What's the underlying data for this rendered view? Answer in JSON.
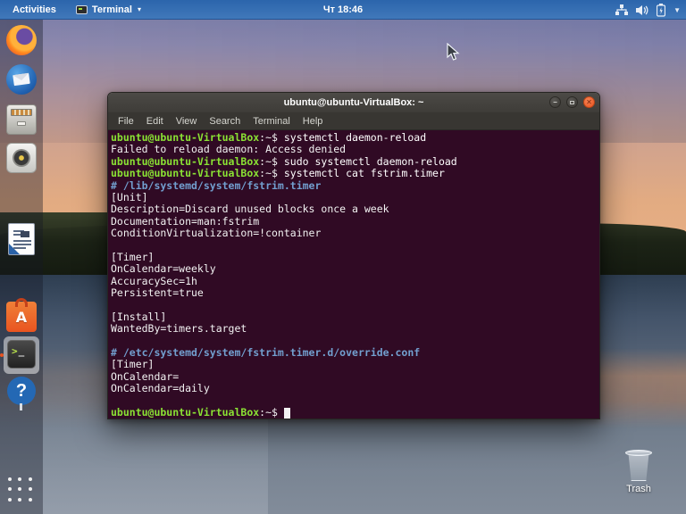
{
  "top_bar": {
    "activities_label": "Activities",
    "app_menu": {
      "label": "Terminal",
      "chevron": "▾"
    },
    "clock": "Чт 18:46",
    "status_icons": [
      "network-wired-icon",
      "volume-icon",
      "battery-icon",
      "chevron-down-icon"
    ]
  },
  "dock": {
    "items": [
      {
        "name": "firefox"
      },
      {
        "name": "thunderbird"
      },
      {
        "name": "files"
      },
      {
        "name": "rhythmbox"
      },
      {
        "name": "libreoffice-writer"
      },
      {
        "name": "ubuntu-software"
      },
      {
        "name": "help"
      },
      {
        "name": "terminal",
        "running": true,
        "focused": true
      }
    ],
    "show_apps": "app-grid"
  },
  "window": {
    "title": "ubuntu@ubuntu-VirtualBox: ~",
    "menu": [
      "File",
      "Edit",
      "View",
      "Search",
      "Terminal",
      "Help"
    ],
    "controls": {
      "minimize": "−",
      "maximize": "",
      "close": "✕"
    }
  },
  "terminal": {
    "lines": [
      [
        [
          "prompt",
          "ubuntu@ubuntu-VirtualBox"
        ],
        [
          "plain",
          ":~$ "
        ],
        [
          "cmd",
          "systemctl daemon-reload"
        ]
      ],
      [
        [
          "plain",
          "Failed to reload daemon: Access denied"
        ]
      ],
      [
        [
          "prompt",
          "ubuntu@ubuntu-VirtualBox"
        ],
        [
          "plain",
          ":~$ "
        ],
        [
          "cmd",
          "sudo systemctl daemon-reload"
        ]
      ],
      [
        [
          "prompt",
          "ubuntu@ubuntu-VirtualBox"
        ],
        [
          "plain",
          ":~$ "
        ],
        [
          "cmd",
          "systemctl cat fstrim.timer"
        ]
      ],
      [
        [
          "comment",
          "# /lib/systemd/system/fstrim.timer"
        ]
      ],
      [
        [
          "plain",
          "[Unit]"
        ]
      ],
      [
        [
          "plain",
          "Description=Discard unused blocks once a week"
        ]
      ],
      [
        [
          "plain",
          "Documentation=man:fstrim"
        ]
      ],
      [
        [
          "plain",
          "ConditionVirtualization=!container"
        ]
      ],
      [],
      [
        [
          "plain",
          "[Timer]"
        ]
      ],
      [
        [
          "plain",
          "OnCalendar=weekly"
        ]
      ],
      [
        [
          "plain",
          "AccuracySec=1h"
        ]
      ],
      [
        [
          "plain",
          "Persistent=true"
        ]
      ],
      [],
      [
        [
          "plain",
          "[Install]"
        ]
      ],
      [
        [
          "plain",
          "WantedBy=timers.target"
        ]
      ],
      [],
      [
        [
          "comment",
          "# /etc/systemd/system/fstrim.timer.d/override.conf"
        ]
      ],
      [
        [
          "plain",
          "[Timer]"
        ]
      ],
      [
        [
          "plain",
          "OnCalendar="
        ]
      ],
      [
        [
          "plain",
          "OnCalendar=daily"
        ]
      ],
      [],
      [
        [
          "prompt",
          "ubuntu@ubuntu-VirtualBox"
        ],
        [
          "plain",
          ":~$ "
        ],
        [
          "cursor",
          ""
        ]
      ]
    ]
  },
  "desktop": {
    "trash_label": "Trash"
  },
  "colors": {
    "terminal_bg": "#300a24",
    "prompt_green": "#8ae234",
    "comment_blue": "#729fcf",
    "accent_orange": "#e95420",
    "topbar_blue": "#2b65ac"
  }
}
